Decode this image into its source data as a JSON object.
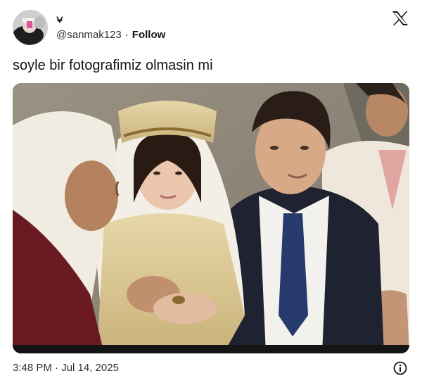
{
  "author": {
    "name_glyph": "⍱",
    "handle": "@sanmak123",
    "separator": "·",
    "follow_label": "Follow"
  },
  "tweet": {
    "text": "soyle bir fotografimiz olmasin mi",
    "timestamp": "3:48 PM · Jul 14, 2025"
  },
  "icons": {
    "brand": "x-logo-icon",
    "info": "info-icon"
  },
  "colors": {
    "text": "#0f1419",
    "secondary_text": "#2f3336",
    "background": "#ffffff"
  }
}
